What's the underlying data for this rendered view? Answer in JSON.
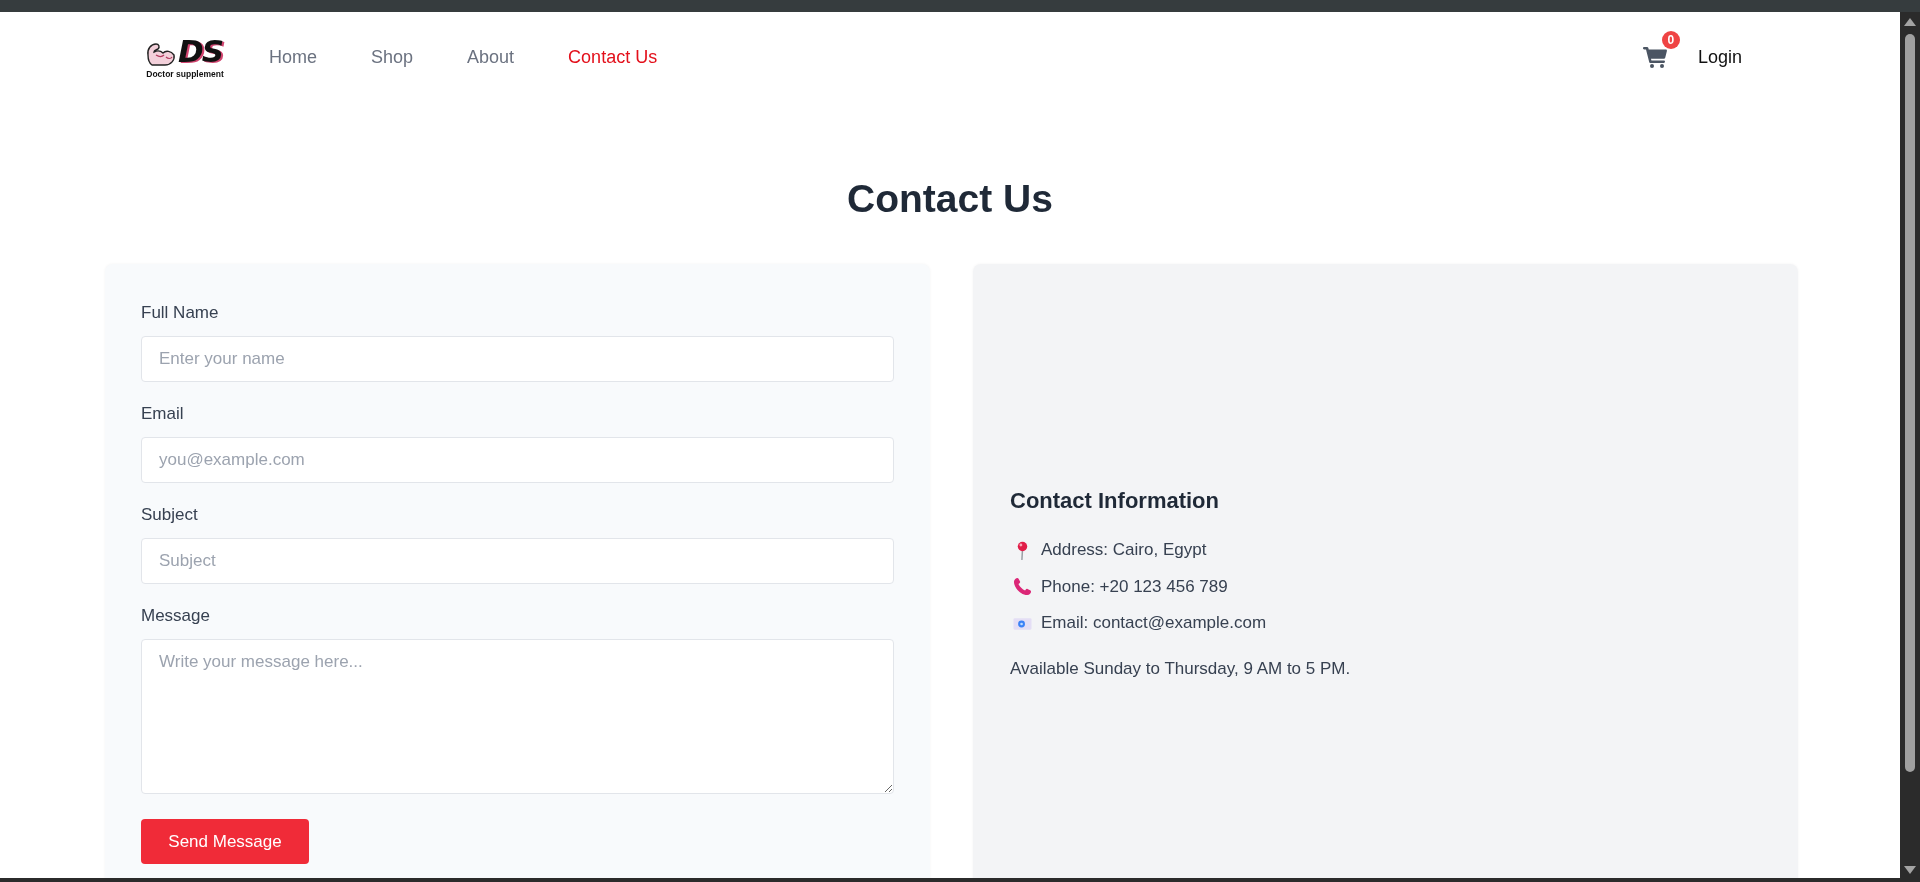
{
  "header": {
    "logo": {
      "mark": "DS",
      "tagline": "Doctor supplement"
    },
    "nav": [
      {
        "label": "Home",
        "selected": false
      },
      {
        "label": "Shop",
        "selected": false
      },
      {
        "label": "About",
        "selected": false
      },
      {
        "label": "Contact Us",
        "selected": true
      }
    ],
    "cart": {
      "badge": "0"
    },
    "login": "Login"
  },
  "page_title": "Contact Us",
  "form": {
    "fields": [
      {
        "kind": "input",
        "label": "Full Name",
        "placeholder": "Enter your name"
      },
      {
        "kind": "input",
        "label": "Email",
        "placeholder": "you@example.com"
      },
      {
        "kind": "input",
        "label": "Subject",
        "placeholder": "Subject"
      },
      {
        "kind": "textarea",
        "label": "Message",
        "placeholder": "Write your message here..."
      }
    ],
    "submit": "Send Message"
  },
  "contact_info": {
    "title": "Contact Information",
    "items": [
      {
        "kind": "address",
        "text": "Address: Cairo, Egypt"
      },
      {
        "kind": "phone",
        "text": "Phone: +20 123 456 789"
      },
      {
        "kind": "email",
        "text": "Email: contact@example.com"
      }
    ],
    "note": "Available Sunday to Thursday, 9 AM to 5 PM."
  }
}
